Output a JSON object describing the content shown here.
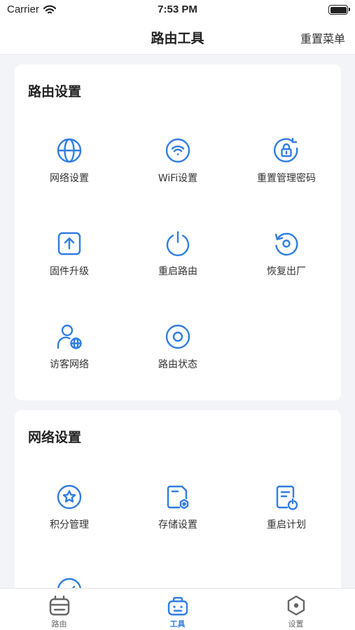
{
  "status_bar": {
    "carrier": "Carrier",
    "time": "7:53 PM"
  },
  "nav": {
    "title": "路由工具",
    "action": "重置菜单"
  },
  "colors": {
    "accent": "#2f7de1",
    "tab_inactive": "#666666",
    "background": "#f2f4f8",
    "card": "#ffffff"
  },
  "sections": [
    {
      "title": "路由设置",
      "items": [
        {
          "label": "网络设置",
          "icon": "globe-icon"
        },
        {
          "label": "WiFi设置",
          "icon": "wifi-icon"
        },
        {
          "label": "重置管理密码",
          "icon": "reset-lock-icon"
        },
        {
          "label": "固件升级",
          "icon": "upload-icon"
        },
        {
          "label": "重启路由",
          "icon": "power-icon"
        },
        {
          "label": "恢复出厂",
          "icon": "restore-icon"
        },
        {
          "label": "访客网络",
          "icon": "guest-network-icon"
        },
        {
          "label": "路由状态",
          "icon": "status-ring-icon"
        }
      ]
    },
    {
      "title": "网络设置",
      "items": [
        {
          "label": "积分管理",
          "icon": "star-badge-icon"
        },
        {
          "label": "存储设置",
          "icon": "storage-icon"
        },
        {
          "label": "重启计划",
          "icon": "schedule-icon"
        }
      ]
    }
  ],
  "tabs": [
    {
      "label": "路由",
      "icon": "router-icon",
      "active": false
    },
    {
      "label": "工具",
      "icon": "toolbox-icon",
      "active": true
    },
    {
      "label": "设置",
      "icon": "settings-hex-icon",
      "active": false
    }
  ]
}
